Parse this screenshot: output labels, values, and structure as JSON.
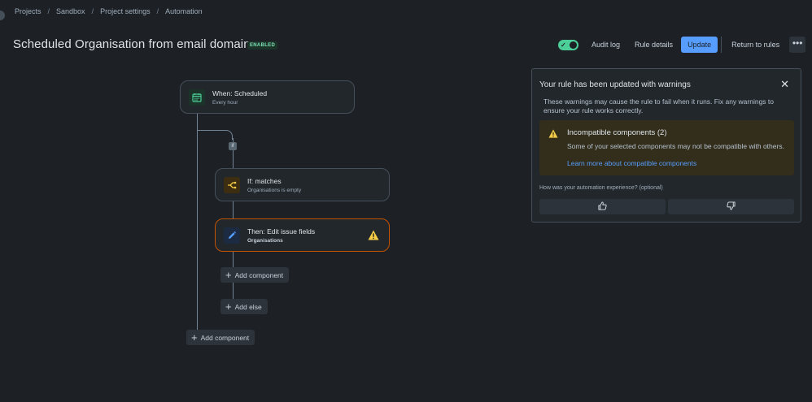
{
  "breadcrumb": [
    "Projects",
    "Sandbox",
    "Project settings",
    "Automation"
  ],
  "breadcrumb_separator": "/",
  "page": {
    "title": "Scheduled Organisation from email domain",
    "status": "ENABLED",
    "status_color": "#7ee2b8"
  },
  "toolbar": {
    "toggle_on": true,
    "toggle_check": "✓",
    "audit_log": "Audit log",
    "rule_details": "Rule details",
    "update": "Update",
    "return_to_rules": "Return to rules",
    "more": "•••"
  },
  "flow": {
    "trigger": {
      "title": "When: Scheduled",
      "subtitle": "Every hour",
      "icon": "calendar-icon"
    },
    "if_badge": "if",
    "condition": {
      "title": "If: matches",
      "subtitle": "Organisations is empty",
      "icon": "branch-icon"
    },
    "action": {
      "title": "Then: Edit issue fields",
      "subtitle": "Organisations",
      "icon": "pencil-icon",
      "has_warning": true
    },
    "add_component_inner": "Add component",
    "add_else": "Add else",
    "add_component_outer": "Add component",
    "plus": "+"
  },
  "warning_panel": {
    "title": "Your rule has been updated with warnings",
    "close": "✕",
    "description": "These warnings may cause the rule to fail when it runs. Fix any warnings to ensure your rule works correctly.",
    "box_title": "Incompatible components (2)",
    "box_text": "Some of your selected components may not be compatible with others.",
    "box_link": "Learn more about compatible components",
    "feedback_question": "How was your automation experience? (optional)",
    "thumbs_up_icon": "thumbs-up-icon",
    "thumbs_down_icon": "thumbs-down-icon"
  },
  "colors": {
    "background": "#1d2125",
    "accent": "#579dff",
    "success": "#4bce97",
    "warning": "#f5cd47",
    "warning_border": "#c25100"
  }
}
